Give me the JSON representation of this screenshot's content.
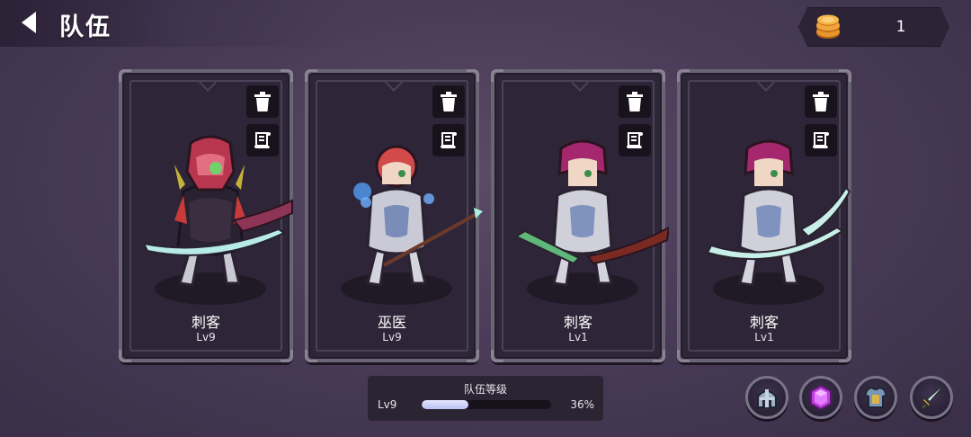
{
  "header": {
    "title": "队伍"
  },
  "currency": {
    "icon": "coin-stack-icon",
    "value": "1"
  },
  "cards": [
    {
      "name": "刺客",
      "level": "Lv9",
      "hero": "assassin-red-armor"
    },
    {
      "name": "巫医",
      "level": "Lv9",
      "hero": "witch-doctor"
    },
    {
      "name": "刺客",
      "level": "Lv1",
      "hero": "assassin"
    },
    {
      "name": "刺客",
      "level": "Lv1",
      "hero": "assassin"
    }
  ],
  "team_level": {
    "title": "队伍等级",
    "level": "Lv9",
    "percent_text": "36%",
    "progress": 0.36
  },
  "bottom_buttons": [
    "helmet-icon",
    "gem-icon",
    "armor-icon",
    "sword-icon"
  ],
  "colors": {
    "background": "#4a3c58",
    "card_border": "#6a6474",
    "gem": "#c03ee0",
    "progress": "#c8cef6"
  }
}
